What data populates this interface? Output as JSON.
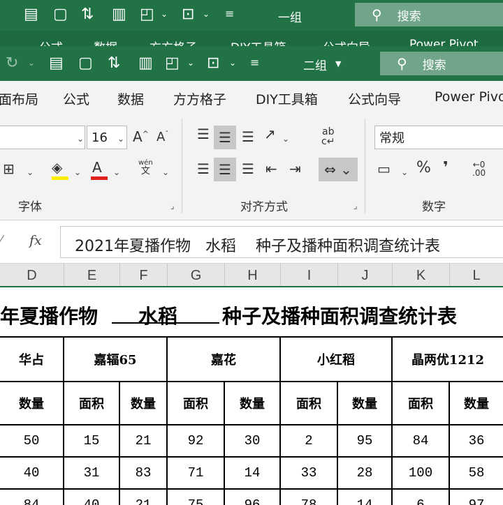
{
  "background_window": {
    "group_label": "一组",
    "search_label": "搜索",
    "tabs": [
      "公式",
      "数据",
      "方方格子",
      "DIY工具箱",
      "公式向导",
      "Power Pivot"
    ]
  },
  "window": {
    "group_label": "二组",
    "search_label": "搜索",
    "tabs": [
      "面布局",
      "公式",
      "数据",
      "方方格子",
      "DIY工具箱",
      "公式向导",
      "Power Pivo"
    ],
    "font_size_value": "16",
    "number_format_value": "常规",
    "group_labels": {
      "font": "字体",
      "alignment": "对齐方式",
      "number": "数字"
    },
    "wen_glyph": "wén",
    "wen_char": "文",
    "ab_glyph": "ab",
    "c_glyph": "c",
    "percent_glyph": "%",
    "comma_glyph": "❜",
    "dec_glyph": "←0",
    "dec_glyph2": ".00"
  },
  "formula_bar": {
    "fx": "fx",
    "content": "2021年夏播作物   水稻    种子及播种面积调查统计表"
  },
  "columns": [
    "D",
    "E",
    "F",
    "G",
    "H",
    "I",
    "J",
    "K",
    "L"
  ],
  "sheet": {
    "title_parts": [
      "年夏播作物",
      "水稻",
      "种子及播种面积调查统计表"
    ],
    "varieties": [
      "华占",
      "嘉辐65",
      "嘉花",
      "小红稻",
      "晶两优1212"
    ],
    "sub_headers": [
      "数量",
      "面积",
      "数量",
      "面积",
      "数量",
      "面积",
      "数量",
      "面积",
      "数量"
    ],
    "rows": [
      [
        "50",
        "15",
        "21",
        "92",
        "30",
        "2",
        "95",
        "84",
        "36"
      ],
      [
        "40",
        "31",
        "83",
        "71",
        "14",
        "33",
        "28",
        "100",
        "58"
      ],
      [
        "84",
        "40",
        "21",
        "75",
        "96",
        "78",
        "14",
        "6",
        "97"
      ]
    ]
  },
  "colors": {
    "excel_green": "#217346",
    "highlight_yellow": "#ffee00",
    "font_red": "#e0201c"
  }
}
